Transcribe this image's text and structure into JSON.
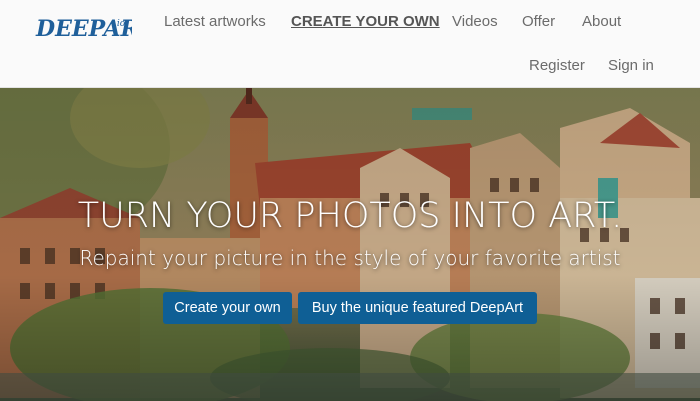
{
  "brand": {
    "logo_text": "DEEPART.io"
  },
  "nav": {
    "items": [
      {
        "label": "Latest artworks"
      },
      {
        "label": "CREATE YOUR OWN",
        "active": true
      },
      {
        "label": "Videos"
      },
      {
        "label": "Offer"
      },
      {
        "label": "About"
      }
    ],
    "account": [
      {
        "label": "Register"
      },
      {
        "label": "Sign in"
      }
    ]
  },
  "hero": {
    "title": "TURN YOUR PHOTOS INTO ART.",
    "subtitle": "Repaint your picture in the style of your favorite artist",
    "buttons": [
      {
        "label": "Create your own"
      },
      {
        "label": "Buy the unique featured DeepArt"
      }
    ]
  },
  "colors": {
    "brand_blue": "#1f5f9a",
    "button_bg": "#0f5f95",
    "nav_text": "#6b6b6b"
  }
}
